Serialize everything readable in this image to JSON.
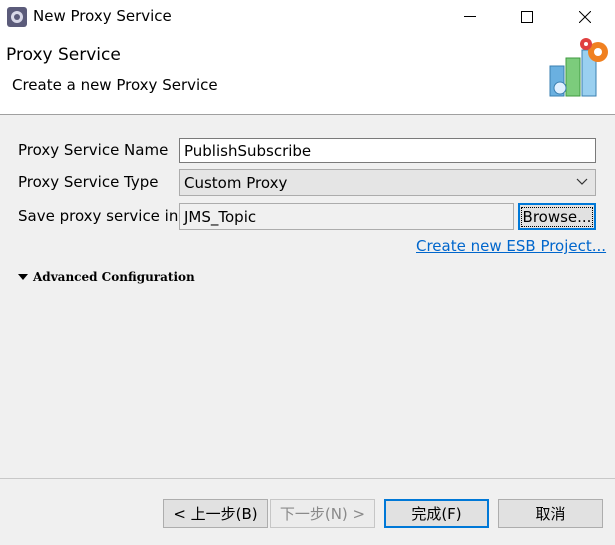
{
  "window": {
    "title": "New Proxy Service"
  },
  "header": {
    "title": "Proxy Service",
    "description": "Create a new Proxy Service"
  },
  "form": {
    "name_label": "Proxy Service Name",
    "name_value": "PublishSubscribe",
    "type_label": "Proxy Service Type",
    "type_value": "Custom Proxy",
    "save_label": "Save proxy service in:",
    "save_value": "JMS_Topic",
    "browse_label": "Browse...",
    "create_project_link": "Create new ESB Project...",
    "advanced_label": "Advanced Configuration"
  },
  "footer": {
    "back_label": "< 上一步(B)",
    "next_label": "下一步(N) >",
    "finish_label": "完成(F)",
    "cancel_label": "取消"
  },
  "icons": {
    "app": "eclipse-gear-icon",
    "minimize": "minimize-icon",
    "maximize": "maximize-icon",
    "close": "close-icon",
    "header_art": "proxy-service-wizard-banner-icon",
    "dropdown": "chevron-down-icon",
    "expand": "triangle-down-icon"
  },
  "colors": {
    "accent": "#0078d7",
    "link": "#0066cc"
  }
}
